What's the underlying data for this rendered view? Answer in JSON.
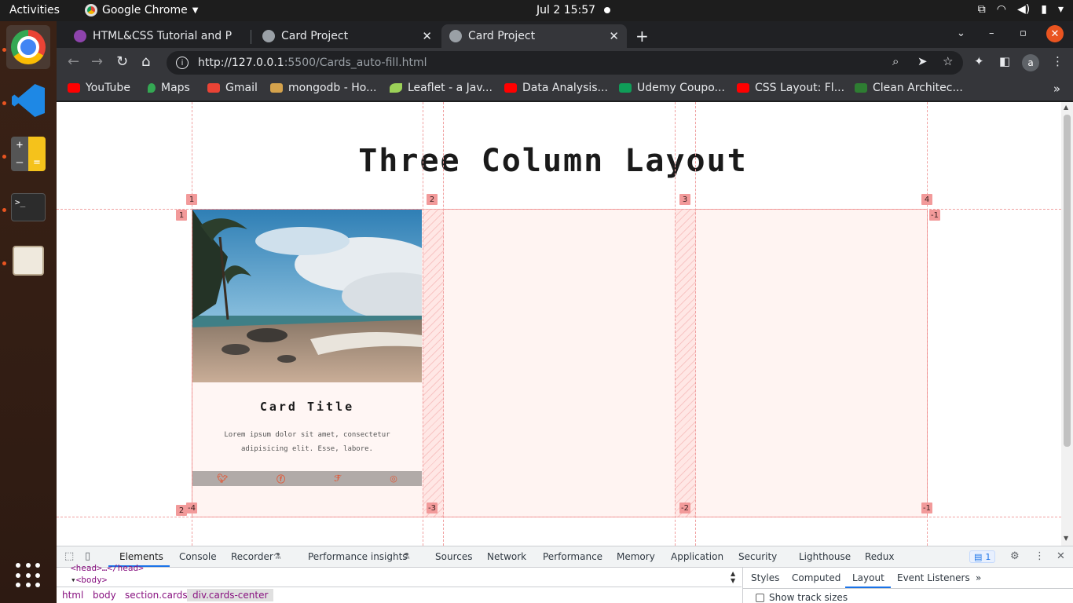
{
  "system": {
    "activities": "Activities",
    "app_menu": "Google Chrome",
    "clock": "Jul 2  15:57"
  },
  "dock": {
    "items": [
      "chrome",
      "vscode",
      "calculator",
      "terminal",
      "files"
    ],
    "terminal_prompt": ">_"
  },
  "browser": {
    "tabs": [
      {
        "title": "HTML&CSS Tutorial and P",
        "active": false
      },
      {
        "title": "Card Project",
        "active": false
      },
      {
        "title": "Card Project",
        "active": true
      }
    ],
    "url_host": "http://127.0.0.1",
    "url_rest": ":5500/Cards_auto-fill.html",
    "profile_initial": "a",
    "bookmarks": [
      {
        "label": "YouTube",
        "color": "#ff0000"
      },
      {
        "label": "Maps",
        "color": "#34a853"
      },
      {
        "label": "Gmail",
        "color": "#ea4335"
      },
      {
        "label": "mongodb - Ho...",
        "color": "#d4a24c"
      },
      {
        "label": "Leaflet - a Jav...",
        "color": "#9bd158"
      },
      {
        "label": "Data Analysis...",
        "color": "#ff0000"
      },
      {
        "label": "Udemy Coupo...",
        "color": "#0f9d58"
      },
      {
        "label": "CSS Layout: Fl...",
        "color": "#ff0000"
      },
      {
        "label": "Clean Architec...",
        "color": "#2e7d32"
      }
    ]
  },
  "page": {
    "title": "Three Column Layout",
    "card": {
      "title": "Card Title",
      "text": "Lorem ipsum dolor sit amet, consectetur adipisicing elit. Esse, labore.",
      "social_icons": [
        "twitter-icon",
        "facebook-icon",
        "foursquare-icon",
        "instagram-icon"
      ]
    },
    "grid_overlay": {
      "column_numbers_top": [
        "1",
        "2",
        "3",
        "4"
      ],
      "column_numbers_bottom": [
        "-4",
        "-3",
        "-2",
        "-1"
      ],
      "row_numbers_left": [
        "1",
        "2"
      ],
      "row_number_right": "-1",
      "highlight_color": "#f08a8a"
    }
  },
  "devtools": {
    "tabs": [
      "Elements",
      "Console",
      "Recorder",
      "Performance insights",
      "Sources",
      "Network",
      "Performance",
      "Memory",
      "Application",
      "Security",
      "Lighthouse",
      "Redux"
    ],
    "active_tab": "Elements",
    "issues_count": "1",
    "dom_lines": [
      "<head>…</head>",
      "<body>"
    ],
    "breadcrumbs": [
      "html",
      "body",
      "section.cards",
      "div.cards-center"
    ],
    "side_tabs": [
      "Styles",
      "Computed",
      "Layout",
      "Event Listeners"
    ],
    "active_side_tab": "Layout",
    "show_track_sizes": "Show track sizes"
  }
}
